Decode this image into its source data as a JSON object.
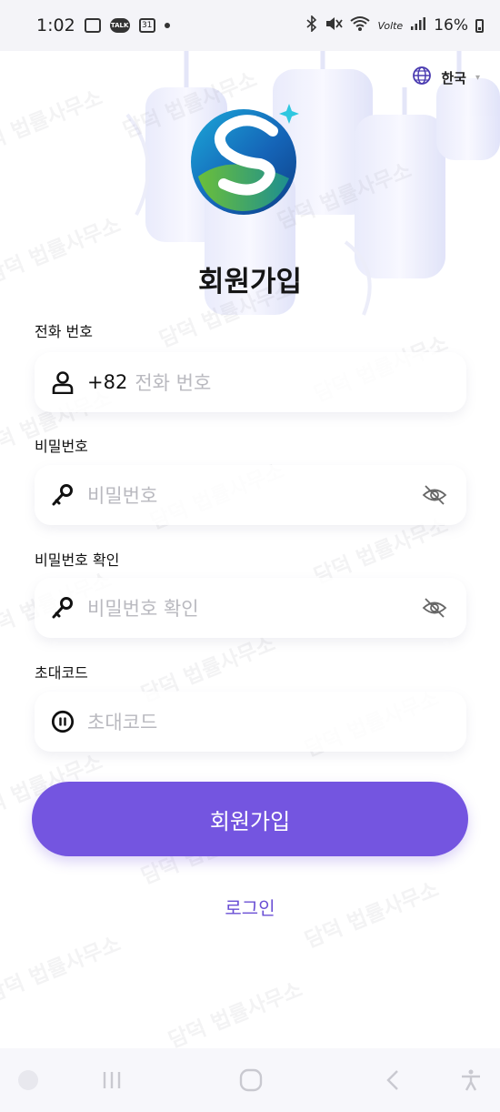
{
  "status_bar": {
    "time": "1:02",
    "calendar_badge": "31",
    "talk_badge": "TALK",
    "battery": "16%",
    "network": "Volte"
  },
  "header": {
    "language": "한국"
  },
  "page": {
    "title": "회원가입"
  },
  "form": {
    "phone": {
      "label": "전화 번호",
      "country_code": "+82",
      "placeholder": "전화 번호"
    },
    "password": {
      "label": "비밀번호",
      "placeholder": "비밀번호"
    },
    "password_confirm": {
      "label": "비밀번호 확인",
      "placeholder": "비밀번호 확인"
    },
    "invite_code": {
      "label": "초대코드",
      "placeholder": "초대코드"
    }
  },
  "actions": {
    "register_label": "회원가입",
    "login_label": "로그인"
  },
  "watermark": "담덕 법률사무소",
  "colors": {
    "primary": "#7455e0",
    "link": "#6a4fd4"
  },
  "icons": [
    "image-icon",
    "talk-icon",
    "calendar-icon",
    "bluetooth-icon",
    "mute-icon",
    "wifi-icon",
    "signal-icon",
    "battery-icon",
    "globe-icon",
    "user-icon",
    "key-icon",
    "eye-off-icon",
    "invite-icon",
    "recent-apps-icon",
    "home-icon",
    "back-icon",
    "accessibility-icon"
  ]
}
